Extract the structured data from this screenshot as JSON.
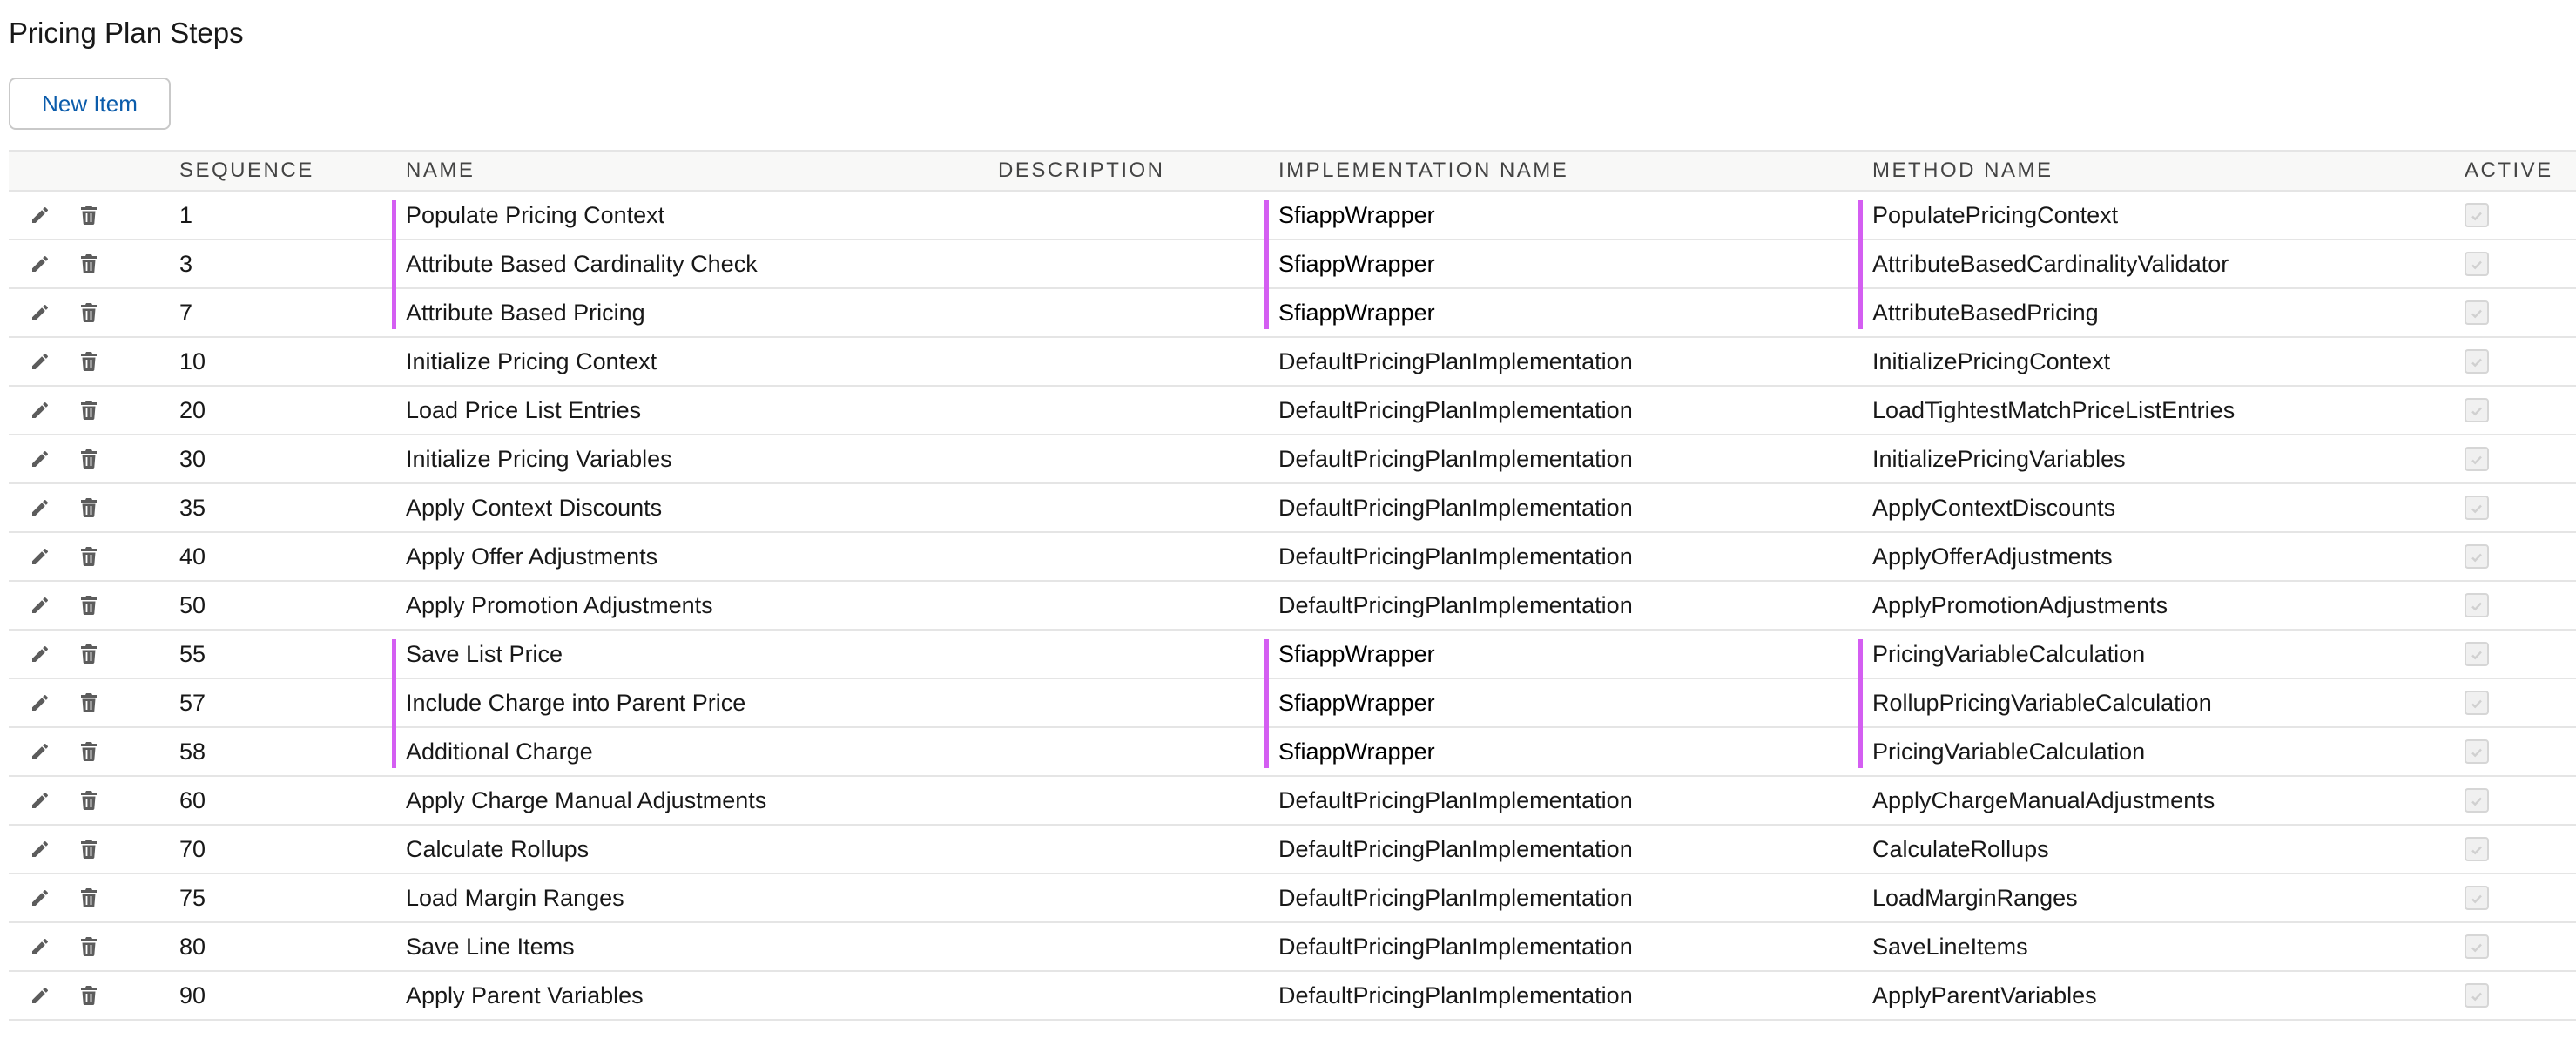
{
  "page": {
    "title": "Pricing Plan Steps",
    "new_item_label": "New Item"
  },
  "table": {
    "columns": {
      "sequence": "Sequence",
      "name": "Name",
      "description": "Description",
      "implementation_name": "Implementation Name",
      "method_name": "Method Name",
      "active": "Active"
    },
    "row_actions": {
      "edit_icon": "pencil-icon",
      "delete_icon": "trash-icon"
    },
    "rows": [
      {
        "sequence": "1",
        "name": "Populate Pricing Context",
        "description": "",
        "implementation_name": "SfiappWrapper",
        "method_name": "PopulatePricingContext",
        "active": true
      },
      {
        "sequence": "3",
        "name": "Attribute Based Cardinality Check",
        "description": "",
        "implementation_name": "SfiappWrapper",
        "method_name": "AttributeBasedCardinalityValidator",
        "active": true
      },
      {
        "sequence": "7",
        "name": "Attribute Based Pricing",
        "description": "",
        "implementation_name": "SfiappWrapper",
        "method_name": "AttributeBasedPricing",
        "active": true
      },
      {
        "sequence": "10",
        "name": "Initialize Pricing Context",
        "description": "",
        "implementation_name": "DefaultPricingPlanImplementation",
        "method_name": "InitializePricingContext",
        "active": true
      },
      {
        "sequence": "20",
        "name": "Load Price List Entries",
        "description": "",
        "implementation_name": "DefaultPricingPlanImplementation",
        "method_name": "LoadTightestMatchPriceListEntries",
        "active": true
      },
      {
        "sequence": "30",
        "name": "Initialize Pricing Variables",
        "description": "",
        "implementation_name": "DefaultPricingPlanImplementation",
        "method_name": "InitializePricingVariables",
        "active": true
      },
      {
        "sequence": "35",
        "name": "Apply Context Discounts",
        "description": "",
        "implementation_name": "DefaultPricingPlanImplementation",
        "method_name": "ApplyContextDiscounts",
        "active": true
      },
      {
        "sequence": "40",
        "name": "Apply Offer Adjustments",
        "description": "",
        "implementation_name": "DefaultPricingPlanImplementation",
        "method_name": "ApplyOfferAdjustments",
        "active": true
      },
      {
        "sequence": "50",
        "name": "Apply Promotion Adjustments",
        "description": "",
        "implementation_name": "DefaultPricingPlanImplementation",
        "method_name": "ApplyPromotionAdjustments",
        "active": true
      },
      {
        "sequence": "55",
        "name": "Save List Price",
        "description": "",
        "implementation_name": "SfiappWrapper",
        "method_name": "PricingVariableCalculation",
        "active": true
      },
      {
        "sequence": "57",
        "name": "Include Charge into Parent Price",
        "description": "",
        "implementation_name": "SfiappWrapper",
        "method_name": "RollupPricingVariableCalculation",
        "active": true
      },
      {
        "sequence": "58",
        "name": "Additional Charge",
        "description": "",
        "implementation_name": "SfiappWrapper",
        "method_name": "PricingVariableCalculation",
        "active": true
      },
      {
        "sequence": "60",
        "name": "Apply Charge Manual Adjustments",
        "description": "",
        "implementation_name": "DefaultPricingPlanImplementation",
        "method_name": "ApplyChargeManualAdjustments",
        "active": true
      },
      {
        "sequence": "70",
        "name": "Calculate Rollups",
        "description": "",
        "implementation_name": "DefaultPricingPlanImplementation",
        "method_name": "CalculateRollups",
        "active": true
      },
      {
        "sequence": "75",
        "name": "Load Margin Ranges",
        "description": "",
        "implementation_name": "DefaultPricingPlanImplementation",
        "method_name": "LoadMarginRanges",
        "active": true
      },
      {
        "sequence": "80",
        "name": "Save Line Items",
        "description": "",
        "implementation_name": "DefaultPricingPlanImplementation",
        "method_name": "SaveLineItems",
        "active": true
      },
      {
        "sequence": "90",
        "name": "Apply Parent Variables",
        "description": "",
        "implementation_name": "DefaultPricingPlanImplementation",
        "method_name": "ApplyParentVariables",
        "active": true
      }
    ]
  },
  "colors": {
    "link_blue": "#0b5cab",
    "highlight_purple": "#d45ef2",
    "border_gray": "#e5e5e5",
    "header_bg": "#f8f8f7",
    "icon_gray": "#5c5c5c"
  }
}
